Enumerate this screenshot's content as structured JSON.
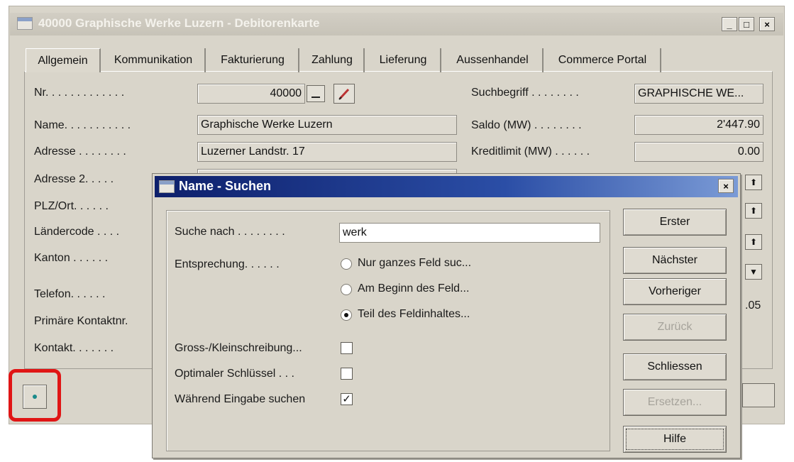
{
  "main_window": {
    "title": "40000 Graphische Werke Luzern - Debitorenkarte",
    "controls": {
      "minimize": "_",
      "maximize": "□",
      "close": "×"
    }
  },
  "tabs": [
    "Allgemein",
    "Kommunikation",
    "Fakturierung",
    "Zahlung",
    "Lieferung",
    "Aussenhandel",
    "Commerce Portal"
  ],
  "form": {
    "left_labels": {
      "nr": "Nr. . . . . . . . . . . . .",
      "name": "Name. . . . . . . . . . .",
      "adresse": "Adresse . . . . . . . .",
      "adresse2": "Adresse 2. . . . .",
      "plz_ort": "PLZ/Ort. . . . . .",
      "laendercode": "Ländercode . . . .",
      "kanton": "Kanton . . . . . .",
      "telefon": "Telefon. . . . . .",
      "primaere_kontaktnr": "Primäre Kontaktnr.",
      "kontakt": "Kontakt. . . . . . ."
    },
    "values": {
      "nr": "40000",
      "name": "Graphische Werke Luzern",
      "adresse": "Luzerner Landstr. 17"
    },
    "right_labels": {
      "suchbegriff": "Suchbegriff . . . . . . . .",
      "saldo": "Saldo (MW) . . . . . . . .",
      "kreditlimit": "Kreditlimit (MW) . . . . . ."
    },
    "right_values": {
      "suchbegriff": "GRAPHISCHE WE...",
      "saldo": "2'447.90",
      "kreditlimit": "0.00"
    },
    "partial_value": ".05"
  },
  "dialog": {
    "title": "Name - Suchen",
    "close": "×",
    "suche_nach_label": "Suche nach . . . . . . . .",
    "suche_nach_value": "werk",
    "entsprechung_label": "Entsprechung. . . . . .",
    "radio_options": [
      {
        "label": "Nur ganzes Feld suc...",
        "selected": false
      },
      {
        "label": "Am Beginn des Feld...",
        "selected": false
      },
      {
        "label": "Teil des Feldinhaltes...",
        "selected": true
      }
    ],
    "checkboxes": [
      {
        "label": "Gross-/Kleinschreibung...",
        "checked": false,
        "mark": ""
      },
      {
        "label": "Optimaler Schlüssel . . .",
        "checked": false,
        "mark": ""
      },
      {
        "label": "Während Eingabe suchen",
        "checked": true,
        "mark": "✓"
      }
    ],
    "buttons": {
      "erster": "Erster",
      "naechster": "Nächster",
      "vorheriger": "Vorheriger",
      "zurueck": "Zurück",
      "schliessen": "Schliessen",
      "ersetzen": "Ersetzen...",
      "hilfe": "Hilfe"
    }
  },
  "colors": {
    "window_bg": "#d9d5ca",
    "dialog_title_from": "#0d1f6b",
    "dialog_title_to": "#7b9bd6",
    "highlight": "#e01515"
  }
}
